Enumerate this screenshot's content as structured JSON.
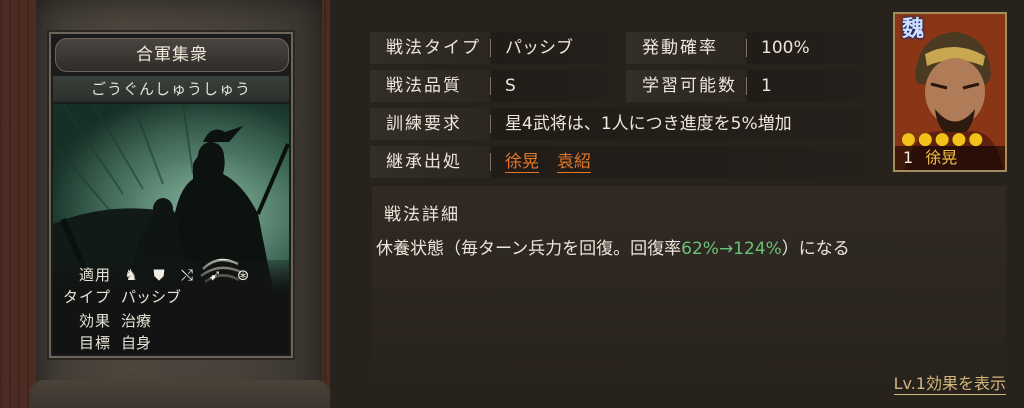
{
  "card": {
    "title": "合軍集衆",
    "reading": "ごうぐんしゅうしゅう",
    "stats": [
      {
        "label": "適用",
        "value": ""
      },
      {
        "label": "タイプ",
        "value": "パッシブ"
      },
      {
        "label": "効果",
        "value": "治療"
      },
      {
        "label": "目標",
        "value": "自身"
      }
    ],
    "unit_icons": [
      "cavalry-icon",
      "shield-icon",
      "bow-icon",
      "spear-icon",
      "siege-wheel-icon"
    ]
  },
  "info": {
    "type_label": "戦法タイプ",
    "type_value": "パッシブ",
    "rate_label": "発動確率",
    "rate_value": "100%",
    "quality_label": "戦法品質",
    "quality_value": "S",
    "learn_label": "学習可能数",
    "learn_value": "1",
    "training_label": "訓練要求",
    "training_value": "星4武将は、1人につき進度を5%増加",
    "inherit_label": "継承出処",
    "inherit_sources": [
      "徐晃",
      "袁紹"
    ]
  },
  "detail": {
    "heading": "戦法詳細",
    "text_before": "休養状態（毎ターン兵力を回復。回復率",
    "highlight": "62%→124%",
    "text_after": "）になる",
    "lv_link": "Lv.1効果を表示"
  },
  "portrait": {
    "kingdom": "魏",
    "stars": 5,
    "level": "1",
    "name": "徐晃"
  },
  "colors": {
    "link_orange": "#e0772c",
    "highlight_green": "#6cc078",
    "star_gold": "#f2c21b"
  }
}
